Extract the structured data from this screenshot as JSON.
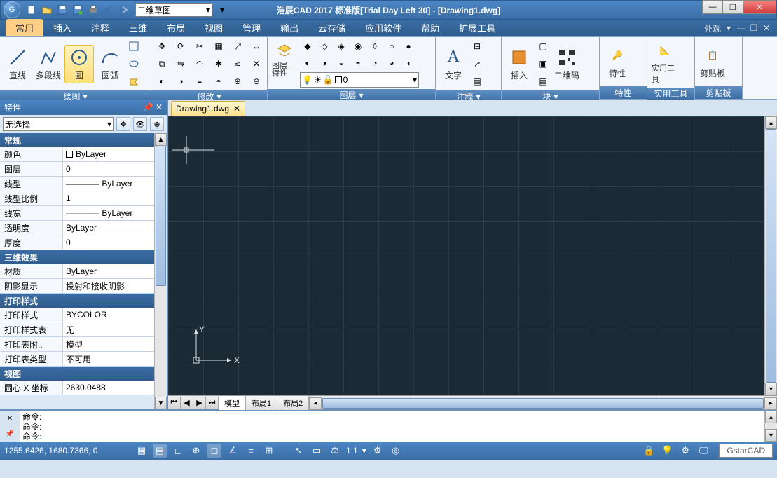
{
  "title": "浩辰CAD 2017 标准版[Trial Day Left 30] - [Drawing1.dwg]",
  "workspace_dropdown": "二维草图",
  "ribbon_tabs": [
    "常用",
    "插入",
    "注释",
    "三维",
    "布局",
    "视图",
    "管理",
    "输出",
    "云存储",
    "应用软件",
    "帮助",
    "扩展工具"
  ],
  "active_tab_index": 0,
  "appearance_menu": "外观",
  "panels": {
    "draw": {
      "title": "绘图",
      "line": "直线",
      "pline": "多段线",
      "circle": "圆",
      "arc": "圆弧"
    },
    "modify": {
      "title": "修改"
    },
    "layer": {
      "title": "图层",
      "props": "图层\n特性",
      "current": "0"
    },
    "annot": {
      "title": "注释",
      "text": "文字"
    },
    "block": {
      "title": "块",
      "insert": "插入",
      "qrcode": "二维码"
    },
    "prop": {
      "title": "特性"
    },
    "util": {
      "title": "实用工具"
    },
    "clip": {
      "title": "剪贴板"
    }
  },
  "properties_panel": {
    "title": "特性",
    "selector": "无选择",
    "groups": [
      {
        "name": "常规",
        "rows": [
          {
            "k": "颜色",
            "v": "ByLayer",
            "swatch": true
          },
          {
            "k": "图层",
            "v": "0"
          },
          {
            "k": "线型",
            "v": "———— ByLayer"
          },
          {
            "k": "线型比例",
            "v": "1"
          },
          {
            "k": "线宽",
            "v": "———— ByLayer"
          },
          {
            "k": "透明度",
            "v": "ByLayer"
          },
          {
            "k": "厚度",
            "v": "0"
          }
        ]
      },
      {
        "name": "三维效果",
        "rows": [
          {
            "k": "材质",
            "v": "ByLayer"
          },
          {
            "k": "阴影显示",
            "v": "投射和接收阴影"
          }
        ]
      },
      {
        "name": "打印样式",
        "rows": [
          {
            "k": "打印样式",
            "v": "BYCOLOR"
          },
          {
            "k": "打印样式表",
            "v": "无"
          },
          {
            "k": "打印表附..",
            "v": "模型"
          },
          {
            "k": "打印表类型",
            "v": "不可用"
          }
        ]
      },
      {
        "name": "视图",
        "rows": [
          {
            "k": "圆心 X 坐标",
            "v": "2630.0488"
          }
        ]
      }
    ]
  },
  "doc_tab": "Drawing1.dwg",
  "layout_tabs": [
    "模型",
    "布局1",
    "布局2"
  ],
  "command_lines": [
    "命令:",
    "命令:",
    "命令:"
  ],
  "status_coords": "1255.6426, 1680.7366, 0",
  "status_scale": "1:1",
  "status_brand": "GstarCAD"
}
